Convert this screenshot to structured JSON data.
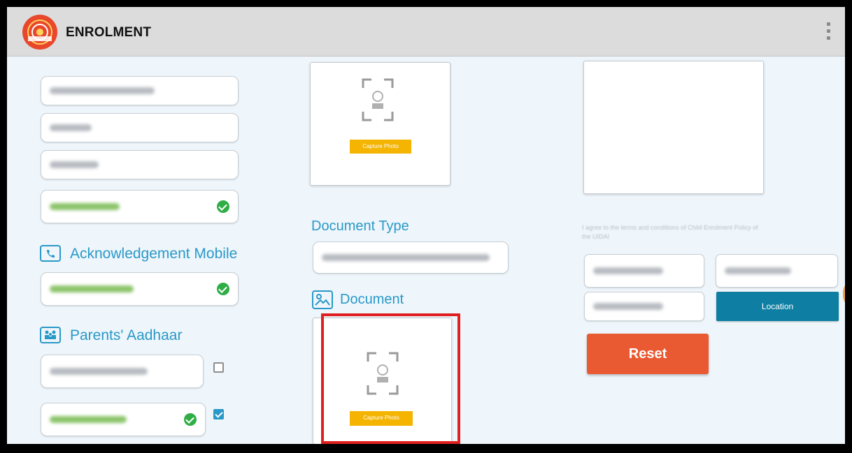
{
  "app": {
    "title": "ENROLMENT",
    "logo_icon": "aadhaar-logo-icon",
    "menu_icon": "overflow-menu-icon"
  },
  "left_column": {
    "ack_mobile_heading": "Acknowledgement Mobile",
    "ack_mobile_icon": "phone-icon",
    "parents_aadhaar_heading": "Parents' Aadhaar",
    "parents_aadhaar_icon": "family-icon"
  },
  "middle_column": {
    "photo_capture_button": "Capture Photo",
    "document_type_label": "Document Type",
    "document_label": "Document",
    "document_icon": "image-icon",
    "document_capture_button": "Capture Photo"
  },
  "right_column": {
    "terms_text": "I agree to the terms and conditions of Child Enrolment Policy of the UIDAI",
    "location_button": "Location",
    "reset_button": "Reset"
  },
  "colors": {
    "accent": "#2a98c8",
    "reset": "#ea5a32",
    "location": "#0e7fa3",
    "capture": "#f4b400",
    "highlight": "#e02020"
  }
}
